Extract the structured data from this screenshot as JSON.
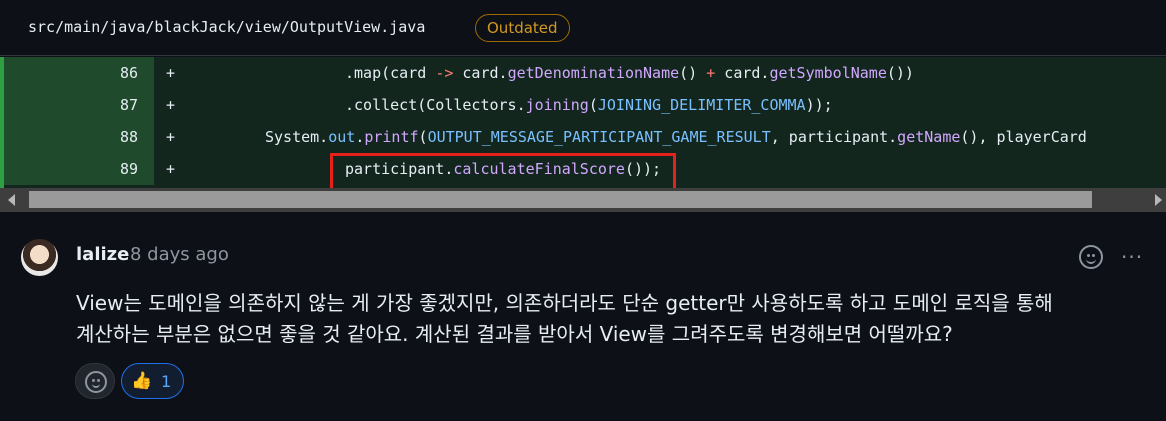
{
  "file": {
    "path": "src/main/java/blackJack/view/OutputView.java",
    "badge": "Outdated"
  },
  "code_lines": [
    {
      "number": "86",
      "marker": "+"
    },
    {
      "number": "87",
      "marker": "+"
    },
    {
      "number": "88",
      "marker": "+"
    },
    {
      "number": "89",
      "marker": "+"
    }
  ],
  "code_tokens": {
    "l86_a": ".map(card ",
    "l86_b": "->",
    "l86_c": " card.",
    "l86_d": "getDenominationName",
    "l86_e": "() ",
    "l86_f": "+",
    "l86_g": " card.",
    "l86_h": "getSymbolName",
    "l86_i": "())",
    "l87_a": ".collect(Collectors.",
    "l87_b": "joining",
    "l87_c": "(",
    "l87_d": "JOINING_DELIMITER_COMMA",
    "l87_e": "));",
    "l88_a": "System.",
    "l88_b": "out",
    "l88_c": ".",
    "l88_d": "printf",
    "l88_e": "(",
    "l88_f": "OUTPUT_MESSAGE_PARTICIPANT_GAME_RESULT",
    "l88_g": ", participant.",
    "l88_h": "getName",
    "l88_i": "(), playerCard",
    "l89_a": "participant.",
    "l89_b": "calculateFinalScore",
    "l89_c": "());"
  },
  "comment": {
    "author": "lalize",
    "time": "8 days ago",
    "body_line1": "View는 도메인을 의존하지 않는 게 가장 좋겠지만, 의존하더라도 단순 getter만 사용하도록 하고 도메인 로직을 통해",
    "body_line2": "계산하는 부분은 없으면 좋을 것 같아요. 계산된 결과를 받아서 View를 그려주도록 변경해보면 어떨까요?",
    "more_glyph": "···",
    "reaction_icon": "👍",
    "reaction_count": "1"
  },
  "icons": {
    "add_reaction": "smiley-icon",
    "thumbs_up": "thumbs-up-icon",
    "more": "kebab-horizontal-icon"
  },
  "colors": {
    "added_line_bg": "#12261e",
    "line_number_bg": "#1f4a2b",
    "highlight_box": "#e5211c",
    "badge": "#d29922",
    "reaction_border": "#1f6feb"
  }
}
